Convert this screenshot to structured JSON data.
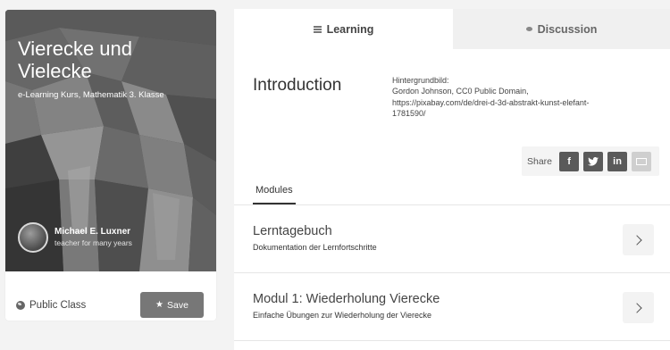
{
  "course": {
    "title": "Vierecke und Vielecke",
    "subtitle": "e-Learning Kurs, Mathematik 3. Klasse",
    "author_name": "Michael E. Luxner",
    "author_role": "teacher for many years",
    "visibility": "Public Class",
    "save_label": "Save",
    "visibility_icon": "globe-icon",
    "save_icon": "star-icon"
  },
  "tabs": [
    {
      "label": "Learning",
      "icon": "lines-icon",
      "active": true
    },
    {
      "label": "Discussion",
      "icon": "bubble-icon",
      "active": false
    }
  ],
  "intro": {
    "title": "Introduction",
    "credit_lines": [
      "Hintergrundbild:",
      "Gordon Johnson, CC0 Public Domain,",
      "https://pixabay.com/de/drei-d-3d-abstrakt-kunst-elefant-",
      "1781590/"
    ]
  },
  "share": {
    "label": "Share",
    "networks": [
      {
        "name": "facebook",
        "glyph": "f"
      },
      {
        "name": "twitter",
        "glyph": "t"
      },
      {
        "name": "linkedin",
        "glyph": "in"
      },
      {
        "name": "email",
        "glyph": ""
      }
    ]
  },
  "modules_tab": "Modules",
  "modules": [
    {
      "title": "Lerntagebuch",
      "description": "Dokumentation der Lernfortschritte"
    },
    {
      "title": "Modul 1: Wiederholung Vierecke",
      "description": "Einfache Übungen zur Wiederholung der Vierecke"
    }
  ],
  "colors": {
    "page_bg": "#f3f3f3",
    "save_button": "#777777",
    "social_icon": "#5a5a5a",
    "inactive_tab": "#f0f0f0"
  }
}
